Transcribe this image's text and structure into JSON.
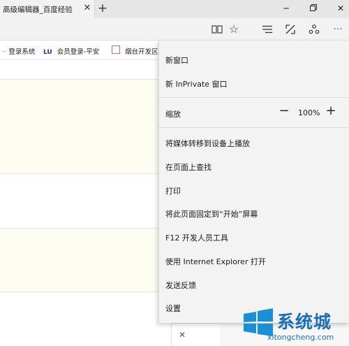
{
  "tab": {
    "title": "高级编辑器_百度经验"
  },
  "favorites": [
    {
      "badge": "ㅡ",
      "label": "登录系统"
    },
    {
      "badge": "LU",
      "label": "会员登录-平安"
    },
    {
      "badge": "",
      "label": "烟台开发区"
    }
  ],
  "menu": {
    "new_window": "新窗口",
    "new_inprivate": "新 InPrivate 窗口",
    "zoom_label": "缩放",
    "zoom_value": "100%",
    "cast_media": "将媒体转移到设备上播放",
    "find_on_page": "在页面上查找",
    "print": "打印",
    "pin_to_start": "将此页面固定到“开始”屏幕",
    "dev_tools": "F12 开发人员工具",
    "open_with_ie": "使用 Internet Explorer 打开",
    "send_feedback": "发送反馈",
    "settings": "设置"
  },
  "watermark": {
    "brand": "系统城",
    "domain": "xitongcheng.com"
  },
  "colors": {
    "menu_bg": "#f3f3f3",
    "page_block": "#fdfdf1",
    "accent": "#1a8fd6"
  },
  "icons": [
    "close-icon",
    "new-tab-icon",
    "minimize-icon",
    "maximize-icon",
    "reading-view-icon",
    "favorite-star-icon",
    "hub-icon",
    "web-note-icon",
    "share-icon",
    "more-icon"
  ]
}
